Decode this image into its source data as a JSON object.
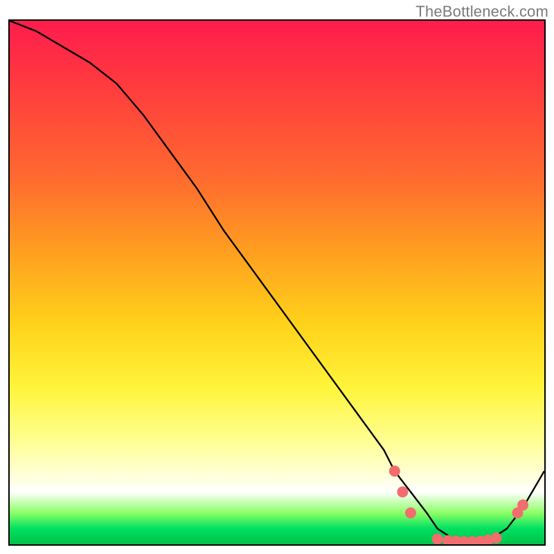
{
  "attribution": "TheBottleneck.com",
  "chart_data": {
    "type": "line",
    "title": "",
    "xlabel": "",
    "ylabel": "",
    "xlim": [
      0,
      100
    ],
    "ylim": [
      0,
      100
    ],
    "series": [
      {
        "name": "curve",
        "x": [
          0,
          5,
          10,
          15,
          20,
          25,
          30,
          35,
          40,
          45,
          50,
          55,
          60,
          65,
          70,
          72,
          75,
          78,
          80,
          83,
          85,
          88,
          90,
          93,
          96,
          100
        ],
        "y": [
          100,
          98,
          95,
          92,
          88,
          82,
          75,
          68,
          60,
          53,
          46,
          39,
          32,
          25,
          18,
          14,
          10,
          6,
          3,
          1,
          0.5,
          0.5,
          1,
          3,
          7,
          14
        ]
      }
    ],
    "markers": [
      {
        "x": 72,
        "y": 14
      },
      {
        "x": 73.5,
        "y": 10
      },
      {
        "x": 75,
        "y": 6
      },
      {
        "x": 80,
        "y": 1
      },
      {
        "x": 82,
        "y": 0.7
      },
      {
        "x": 83.5,
        "y": 0.6
      },
      {
        "x": 85,
        "y": 0.5
      },
      {
        "x": 86.5,
        "y": 0.5
      },
      {
        "x": 88,
        "y": 0.6
      },
      {
        "x": 89.5,
        "y": 0.8
      },
      {
        "x": 91,
        "y": 1.2
      },
      {
        "x": 95,
        "y": 6
      },
      {
        "x": 96,
        "y": 7.5
      }
    ],
    "marker_color": "#f26d6d",
    "curve_color": "#000000"
  }
}
